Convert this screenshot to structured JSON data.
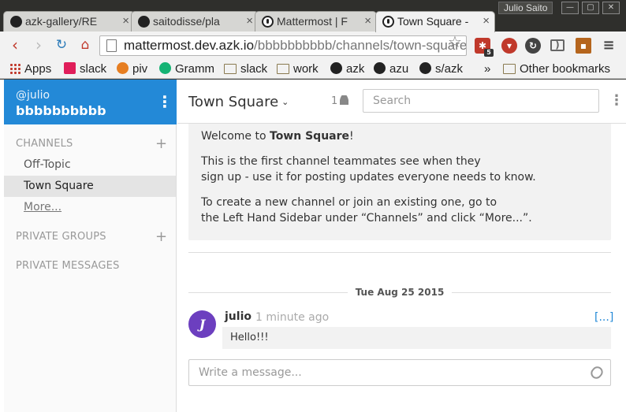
{
  "browser": {
    "tabs": [
      {
        "label": "azk-gallery/RE",
        "icon": "github-icon"
      },
      {
        "label": "saitodisse/pla",
        "icon": "github-icon"
      },
      {
        "label": "Mattermost | F",
        "icon": "mattermost-icon"
      },
      {
        "label": "Town Square -",
        "icon": "mattermost-icon"
      }
    ],
    "window_user": "Julio Saito",
    "url_host": "mattermost.dev.azk.io",
    "url_path": "/bbbbbbbbbb/channels/town-square",
    "extension_badge": "5",
    "bookmarks": [
      {
        "label": "Apps",
        "icon": "apps-grid-icon"
      },
      {
        "label": "slack",
        "icon": "slack-icon"
      },
      {
        "label": "piv",
        "icon": "pivotal-icon"
      },
      {
        "label": "Gramm",
        "icon": "grammarly-icon"
      },
      {
        "label": "slack",
        "icon": "folder-icon"
      },
      {
        "label": "work",
        "icon": "folder-icon"
      },
      {
        "label": "azk",
        "icon": "github-icon"
      },
      {
        "label": "azu",
        "icon": "github-icon"
      },
      {
        "label": "s/azk",
        "icon": "github-icon"
      }
    ],
    "bookmarks_overflow": "»",
    "other_bookmarks": "Other bookmarks"
  },
  "sidebar": {
    "user": "@julio",
    "team": "bbbbbbbbbb",
    "menu_glyph": "⋮",
    "channels_title": "CHANNELS",
    "add_glyph": "+",
    "channels": [
      {
        "label": "Off-Topic",
        "active": false
      },
      {
        "label": "Town Square",
        "active": true
      }
    ],
    "more_label": "More...",
    "private_groups_title": "PRIVATE GROUPS",
    "private_messages_title": "PRIVATE MESSAGES"
  },
  "header": {
    "channel_name": "Town Square",
    "dropdown_glyph": "⌄",
    "member_count": "1",
    "search_placeholder": "Search",
    "menu_glyph": "⋮"
  },
  "intro": {
    "line1_prefix": "Welcome to ",
    "line1_bold": "Town Square",
    "line1_suffix": "!",
    "para2_line1": "This is the first channel teammates see when they",
    "para2_line2": "sign up - use it for posting updates everyone needs to know.",
    "para3_line1": "To create a new channel or join an existing one, go to",
    "para3_line2": "the Left Hand Sidebar under “Channels” and click “More...”."
  },
  "date_separator": "Tue Aug 25 2015",
  "post": {
    "avatar_letter": "J",
    "user": "julio",
    "time": "1 minute ago",
    "more": "[...]",
    "message": "Hello!!!"
  },
  "composer": {
    "placeholder": "Write a message..."
  },
  "colors": {
    "accent": "#2389d7",
    "avatar": "#6c3fbf"
  }
}
